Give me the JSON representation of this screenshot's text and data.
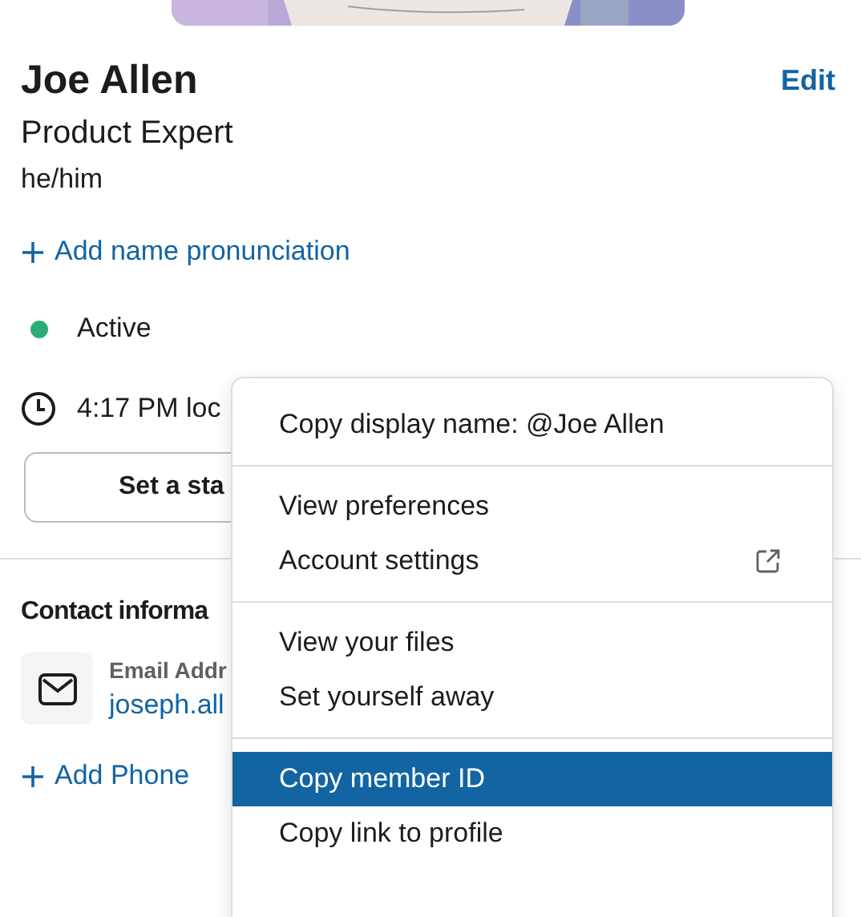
{
  "profile": {
    "name": "Joe Allen",
    "edit_link": "Edit",
    "title": "Product Expert",
    "pronouns": "he/him",
    "add_pronunciation": "Add name pronunciation",
    "status": {
      "label": "Active",
      "active": true
    },
    "local_time": "4:17 PM loc",
    "status_button": "Set a sta"
  },
  "contact": {
    "heading": "Contact informa",
    "email_label": "Email Addr",
    "email": "joseph.all",
    "add_phone": "Add Phone"
  },
  "menu": {
    "sections": [
      [
        {
          "label": "Copy display name: @Joe Allen",
          "external": false,
          "selected": false
        }
      ],
      [
        {
          "label": "View preferences",
          "external": false,
          "selected": false
        },
        {
          "label": "Account settings",
          "external": true,
          "selected": false
        }
      ],
      [
        {
          "label": "View your files",
          "external": false,
          "selected": false
        },
        {
          "label": "Set yourself away",
          "external": false,
          "selected": false
        }
      ],
      [
        {
          "label": "Copy member ID",
          "external": false,
          "selected": true
        },
        {
          "label": "Copy link to profile",
          "external": false,
          "selected": false
        }
      ]
    ]
  }
}
